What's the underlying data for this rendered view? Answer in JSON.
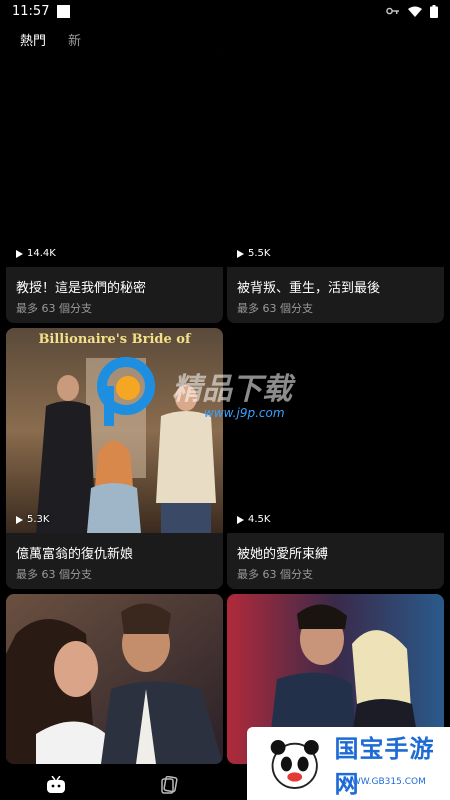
{
  "status": {
    "time": "11:57"
  },
  "tabs": [
    {
      "label": "熱門",
      "active": true
    },
    {
      "label": "新",
      "active": false
    }
  ],
  "cards": [
    {
      "title": "教授！這是我們的秘密",
      "subtitle": "最多 63 個分支",
      "views": "14.4K",
      "image": "black"
    },
    {
      "title": "被背叛、重生，活到最後",
      "subtitle": "最多 63 個分支",
      "views": "5.5K",
      "image": "black"
    },
    {
      "title": "億萬富翁的復仇新娘",
      "subtitle": "最多 63 個分支",
      "views": "5.3K",
      "image": "poster",
      "poster_text": "Billionaire's Bride of"
    },
    {
      "title": "被她的愛所束縛",
      "subtitle": "最多 63 個分支",
      "views": "4.5K",
      "image": "black"
    },
    {
      "title": "",
      "subtitle": "",
      "views": "",
      "image": "couple"
    },
    {
      "title": "",
      "subtitle": "",
      "views": "",
      "image": "couple-neon"
    }
  ],
  "watermark": {
    "text": "精品下载",
    "url": "www.j9p.com"
  },
  "badge": {
    "text": "国宝手游网",
    "url": "WWW.GB315.COM"
  },
  "colors": {
    "background": "#000000",
    "card_info": "#1b1b1b",
    "muted_text": "#9a9a9a",
    "accent": "#1e6bd6"
  },
  "icons": [
    "wifi-key-icon",
    "wifi-icon",
    "battery-icon",
    "play-icon",
    "home-tv-icon",
    "cards-icon",
    "panda-icon"
  ]
}
